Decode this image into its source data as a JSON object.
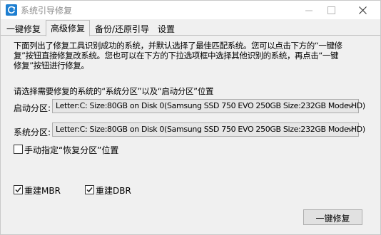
{
  "window": {
    "title": "系统引导修复",
    "icons": {
      "app": "refresh-icon",
      "minimize": "minimize-icon",
      "maximize": "maximize-icon",
      "close": "close-icon"
    }
  },
  "tabs": [
    {
      "label": "一键修复",
      "active": false
    },
    {
      "label": "高级修复",
      "active": true
    },
    {
      "label": "备份/还原引导",
      "active": false
    },
    {
      "label": "设置",
      "active": false
    }
  ],
  "main": {
    "description_lines": [
      "下面列出了修复工具识别成功的系统，并默认选择了最佳匹配系统。您可以点击下方的“一键修",
      "复”按钮直接修复改系统。您也可以在下方的下拉选项框中选择其他识别的系统，再点击“一键",
      "修复”按钮进行修复。"
    ],
    "prompt": "请选择需要修复的系统的“系统分区”以及“启动分区”位置",
    "boot_partition": {
      "label": "启动分区:",
      "value": "Letter:C: Size:80GB on Disk 0(Samsung SSD 750 EVO 250GB Size:232GB Mode:HD)"
    },
    "system_partition": {
      "label": "系统分区:",
      "value": "Letter:C: Size:80GB on Disk 0(Samsung SSD 750 EVO 250GB Size:232GB Mode:HD)"
    },
    "manual_recovery": {
      "label": "手动指定“恢复分区”位置",
      "checked": false
    },
    "rebuild_mbr": {
      "label": "重建MBR",
      "checked": true
    },
    "rebuild_dbr": {
      "label": "重建DBR",
      "checked": true
    },
    "action_button": "一键修复"
  }
}
